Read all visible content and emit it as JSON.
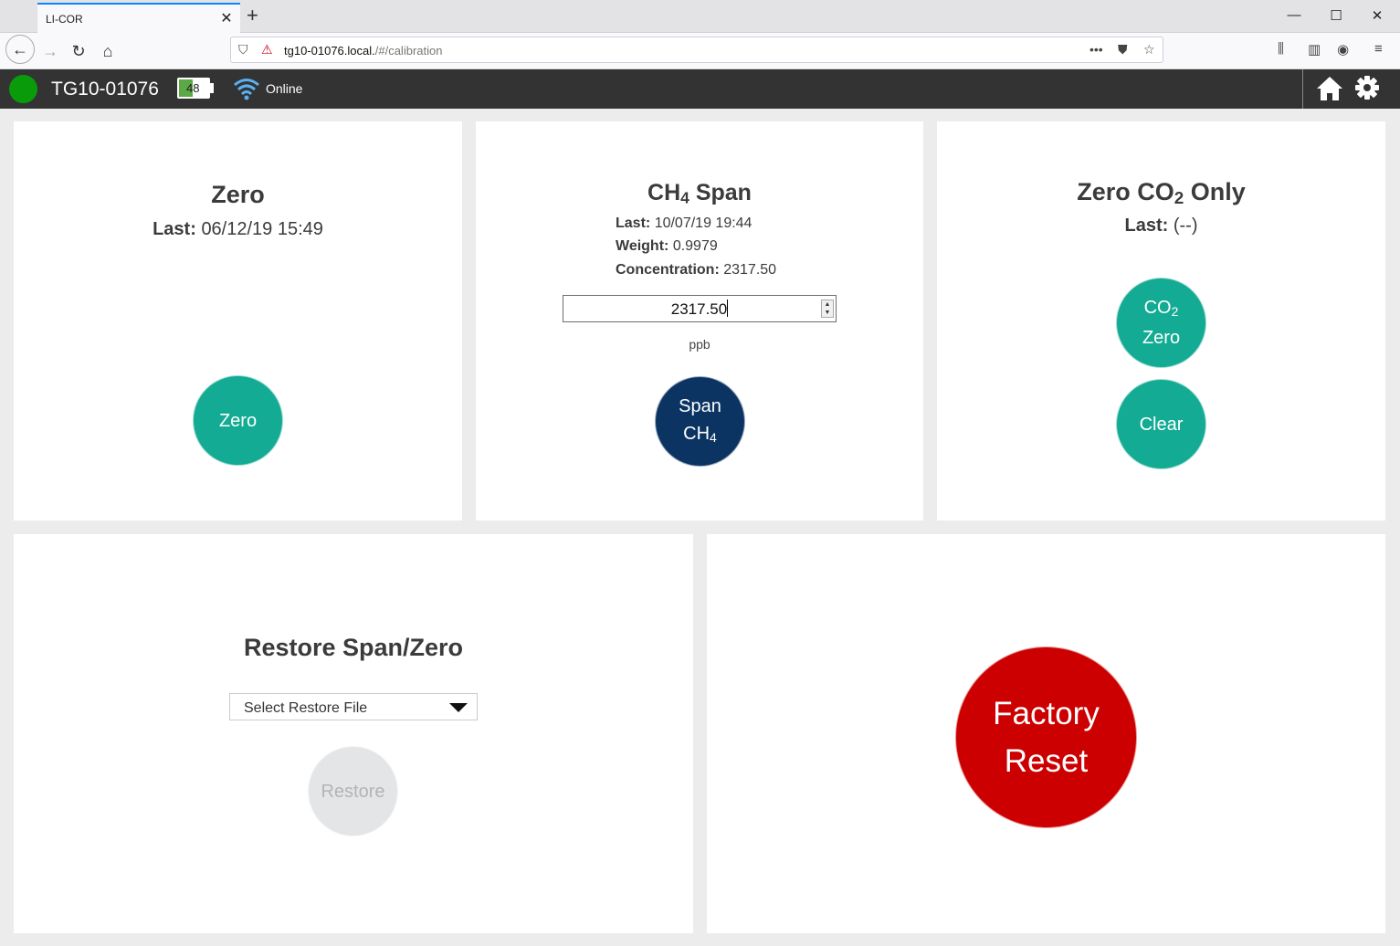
{
  "browser": {
    "tab_title": "LI-COR",
    "url_host": "tg10-01076.local.",
    "url_path": "/#/calibration"
  },
  "header": {
    "device_name": "TG10-01076",
    "battery_level": "48",
    "battery_fraction": 0.48,
    "network_status": "Online",
    "status_color": "#0a9b0a"
  },
  "zero_panel": {
    "title": "Zero",
    "last_label": "Last:",
    "last_value": "06/12/19 15:49",
    "button_label": "Zero"
  },
  "span_panel": {
    "title_prefix": "CH",
    "title_sub": "4",
    "title_suffix": " Span",
    "last_label": "Last:",
    "last_value": "10/07/19 19:44",
    "weight_label": "Weight:",
    "weight_value": "0.9979",
    "concentration_label": "Concentration:",
    "concentration_value": "2317.50",
    "input_value": "2317.50",
    "unit": "ppb",
    "button_line1": "Span",
    "button_line2_prefix": "CH",
    "button_line2_sub": "4"
  },
  "co2_panel": {
    "title_prefix": "Zero CO",
    "title_sub": "2",
    "title_suffix": " Only",
    "last_label": "Last:",
    "last_value": "(--)",
    "zero_button_prefix": "CO",
    "zero_button_sub": "2",
    "zero_button_line2": "Zero",
    "clear_button": "Clear"
  },
  "restore_panel": {
    "title": "Restore Span/Zero",
    "select_label": "Select Restore File",
    "button_label": "Restore"
  },
  "factory_panel": {
    "button_line1": "Factory",
    "button_line2": "Reset"
  },
  "colors": {
    "teal": "#13ab93",
    "navy": "#0c3462",
    "red": "#cc0000",
    "header_bg": "#333333"
  }
}
